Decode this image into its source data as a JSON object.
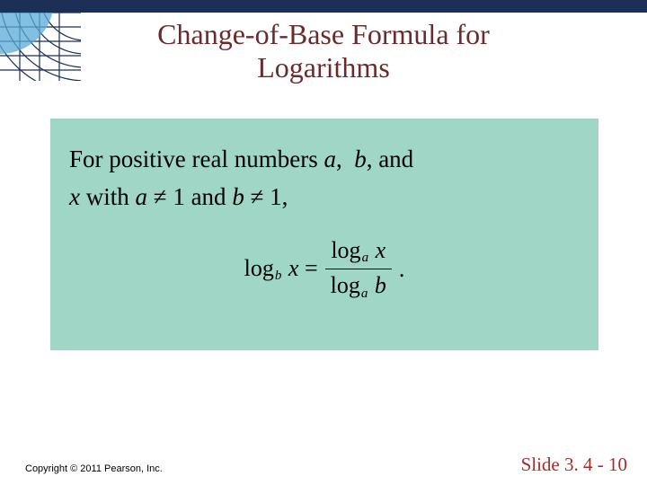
{
  "header": {
    "title_line1": "Change-of-Base Formula for",
    "title_line2": "Logarithms"
  },
  "body": {
    "statement_prefix": "For positive real numbers ",
    "var_a": "a",
    "comma_ab": ", ",
    "var_b": "b",
    "comma_band": ", and",
    "var_x": "x",
    "with_text": " with ",
    "cond_a": "a",
    "ne1": " ≠ 1",
    "and_text": " and ",
    "cond_b": "b",
    "ne1b": " ≠ 1,",
    "formula": {
      "lhs_log": "log",
      "lhs_sub": "b",
      "lhs_var": "x",
      "eq": " = ",
      "num_log": "log",
      "num_sub": "a",
      "num_var": "x",
      "den_log": "log",
      "den_sub": "a",
      "den_var": "b",
      "period": "."
    }
  },
  "footer": {
    "copyright": "Copyright © 2011 Pearson, Inc.",
    "slide": "Slide 3. 4 - 10"
  },
  "colors": {
    "topbar": "#1c2f57",
    "title": "#6b2b2b",
    "panel": "#9fd6c6",
    "slide_num": "#a62b2b"
  }
}
